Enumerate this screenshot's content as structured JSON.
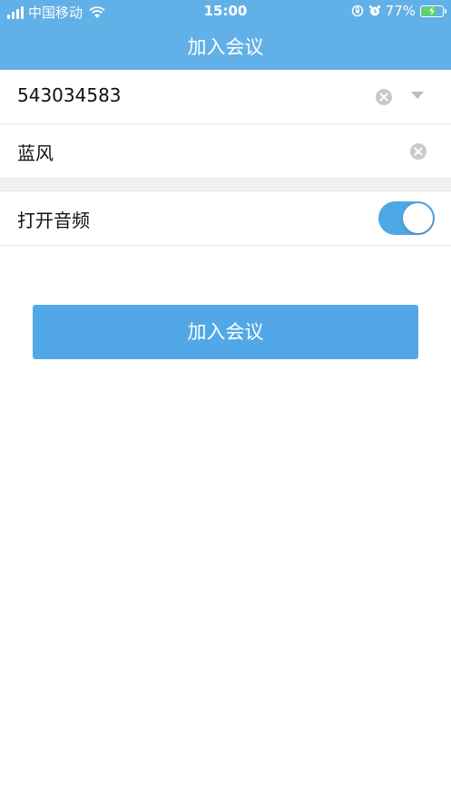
{
  "status_bar": {
    "carrier": "中国移动",
    "time": "15:00",
    "battery_percent": "77%",
    "battery_level": 0.77,
    "icons": [
      "signal-icon",
      "wifi-icon",
      "orientation-lock-icon",
      "alarm-icon",
      "battery-charging-icon"
    ]
  },
  "nav": {
    "title": "加入会议"
  },
  "form": {
    "meeting_id": {
      "value": "543034583"
    },
    "display_name": {
      "value": "蓝风"
    },
    "audio": {
      "label": "打开音频",
      "enabled": true
    }
  },
  "join_button": {
    "label": "加入会议"
  },
  "colors": {
    "header": "#62b0e8",
    "accent": "#52a8e6",
    "toggle_on": "#50a7e6",
    "separator_band": "#f0f0f0"
  }
}
